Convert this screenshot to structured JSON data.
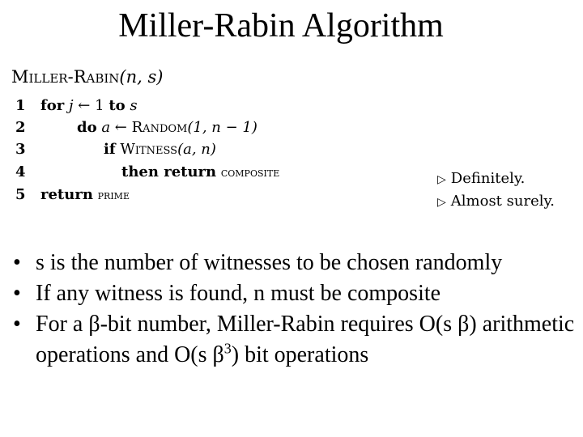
{
  "title": "Miller-Rabin Algorithm",
  "pseudocode": {
    "procedure": "Miller-Rabin",
    "params": "(n, s)",
    "lines": [
      {
        "num": "1",
        "kw1": "for",
        "var": "j",
        "arrow": "←",
        "val": "1",
        "kw2": "to",
        "end": "s"
      },
      {
        "num": "2",
        "kw1": "do",
        "var": "a",
        "arrow": "←",
        "fn": "Random",
        "args": "(1, n − 1)"
      },
      {
        "num": "3",
        "kw1": "if",
        "fn": "Witness",
        "args": "(a, n)"
      },
      {
        "num": "4",
        "kw1": "then return",
        "const": "composite"
      },
      {
        "num": "5",
        "kw1": "return",
        "const": "prime"
      }
    ],
    "comments": [
      {
        "marker": "▷",
        "text": "Definitely."
      },
      {
        "marker": "▷",
        "text": "Almost surely."
      }
    ]
  },
  "bullets": [
    {
      "marker": "•",
      "text": "s is the number of witnesses to be chosen randomly"
    },
    {
      "marker": "•",
      "text": "If any witness is found, n must be composite"
    },
    {
      "marker": "•",
      "text_a": "For a β-bit number, Miller-Rabin requires O(s β) arithmetic operations and O(s β",
      "sup": "3",
      "text_b": ") bit operations"
    }
  ]
}
